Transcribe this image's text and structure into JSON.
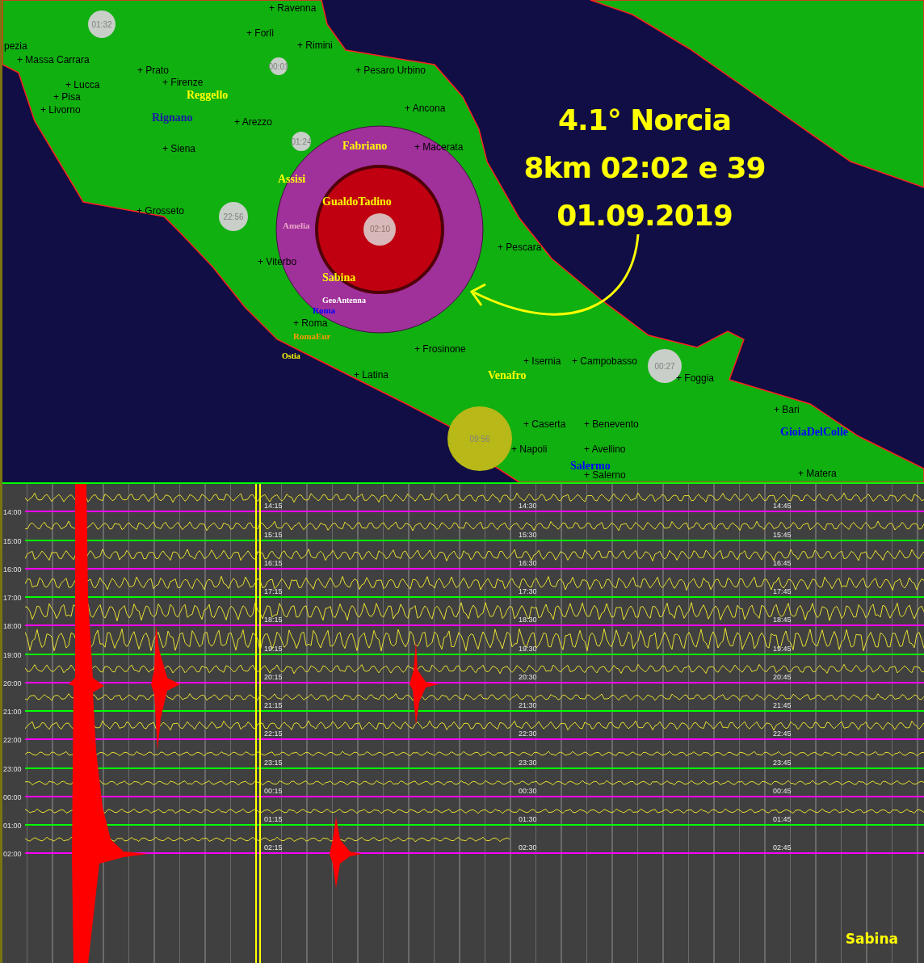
{
  "map": {
    "cities": [
      {
        "name": "+ Ravenna"
      },
      {
        "name": "+ Forlì"
      },
      {
        "name": "+ Rimini"
      },
      {
        "name": "pezia"
      },
      {
        "name": "+ Massa Carrara"
      },
      {
        "name": "+ Prato"
      },
      {
        "name": "+ Firenze"
      },
      {
        "name": "+ Lucca"
      },
      {
        "name": "+ Pisa"
      },
      {
        "name": "+ Livorno"
      },
      {
        "name": "+ Pesaro Urbino"
      },
      {
        "name": "+ Ancona"
      },
      {
        "name": "+ Arezzo"
      },
      {
        "name": "+ Siena"
      },
      {
        "name": "+ Macerata"
      },
      {
        "name": "+ Grosseto"
      },
      {
        "name": "+ Viterbo"
      },
      {
        "name": "+ Pescara"
      },
      {
        "name": "+ Roma"
      },
      {
        "name": "+ Frosinone"
      },
      {
        "name": "+ Latina"
      },
      {
        "name": "+ Isernia"
      },
      {
        "name": "+ Campobasso"
      },
      {
        "name": "+ Foggia"
      },
      {
        "name": "+ Bari"
      },
      {
        "name": "+ Caserta"
      },
      {
        "name": "+ Benevento"
      },
      {
        "name": "+ Napoli"
      },
      {
        "name": "+ Avellino"
      },
      {
        "name": "+ Salerno"
      },
      {
        "name": "+ Matera"
      }
    ],
    "stations": [
      {
        "name": "Reggello",
        "color": "#ffff00"
      },
      {
        "name": "Rignano",
        "color": "#1a1aa8"
      },
      {
        "name": "Fabriano",
        "color": "#ffff00"
      },
      {
        "name": "Assisi",
        "color": "#ffff00"
      },
      {
        "name": "GualdoTadino",
        "color": "#ffff00"
      },
      {
        "name": "Amelia",
        "color": "#e8a8c8"
      },
      {
        "name": "Sabina",
        "color": "#ffff00"
      },
      {
        "name": "GeoAntenna",
        "color": "#ffffff"
      },
      {
        "name": "Roma",
        "color": "#0000ff"
      },
      {
        "name": "RomaEur",
        "color": "#ff9900"
      },
      {
        "name": "Ostia",
        "color": "#ffff00"
      },
      {
        "name": "Venafro",
        "color": "#ffff00"
      },
      {
        "name": "Salermo",
        "color": "#0000ff"
      },
      {
        "name": "GioiaDelColle",
        "color": "#0000ff"
      }
    ],
    "time_bubbles": [
      {
        "time": "01:32",
        "color": "#c8cec8"
      },
      {
        "time": "00:01",
        "color": "#c8cec8"
      },
      {
        "time": "01:24",
        "color": "#c8cec8"
      },
      {
        "time": "22:56",
        "color": "#c8cec8"
      },
      {
        "time": "00:27",
        "color": "#c8cec8"
      },
      {
        "time": "09:56",
        "color": "#b8b818"
      }
    ],
    "epicenter": {
      "time": "02:10"
    },
    "annotation": [
      "4.1° Norcia",
      "8km 02:02 e 39",
      "01.09.2019"
    ]
  },
  "seismogram": {
    "rows": [
      {
        "hour": "14:00",
        "marks": [
          "14:15",
          "14:30",
          "14:45"
        ],
        "color": "#ff00ff"
      },
      {
        "hour": "15:00",
        "marks": [
          "15:15",
          "15:30",
          "15:45"
        ],
        "color": "#00ff00"
      },
      {
        "hour": "16:00",
        "marks": [
          "16:15",
          "16:30",
          "16:45"
        ],
        "color": "#ff00ff"
      },
      {
        "hour": "17:00",
        "marks": [
          "17:15",
          "17:30",
          "17:45"
        ],
        "color": "#00ff00"
      },
      {
        "hour": "18:00",
        "marks": [
          "18:15",
          "18:30",
          "18:45"
        ],
        "color": "#ff00ff"
      },
      {
        "hour": "19:00",
        "marks": [
          "19:15",
          "19:30",
          "19:45"
        ],
        "color": "#00ff00"
      },
      {
        "hour": "20:00",
        "marks": [
          "20:15",
          "20:30",
          "20:45"
        ],
        "color": "#ff00ff"
      },
      {
        "hour": "21:00",
        "marks": [
          "21:15",
          "21:30",
          "21:45"
        ],
        "color": "#00ff00"
      },
      {
        "hour": "22:00",
        "marks": [
          "22:15",
          "22:30",
          "22:45"
        ],
        "color": "#ff00ff"
      },
      {
        "hour": "23:00",
        "marks": [
          "23:15",
          "23:30",
          "23:45"
        ],
        "color": "#00ff00"
      },
      {
        "hour": "00:00",
        "marks": [
          "00:15",
          "00:30",
          "00:45"
        ],
        "color": "#ff00ff"
      },
      {
        "hour": "01:00",
        "marks": [
          "01:15",
          "01:30",
          "01:45"
        ],
        "color": "#00ff00"
      },
      {
        "hour": "02:00",
        "marks": [
          "02:15",
          "02:30",
          "02:45"
        ],
        "color": "#ff00ff"
      }
    ],
    "station": "Sabina"
  }
}
